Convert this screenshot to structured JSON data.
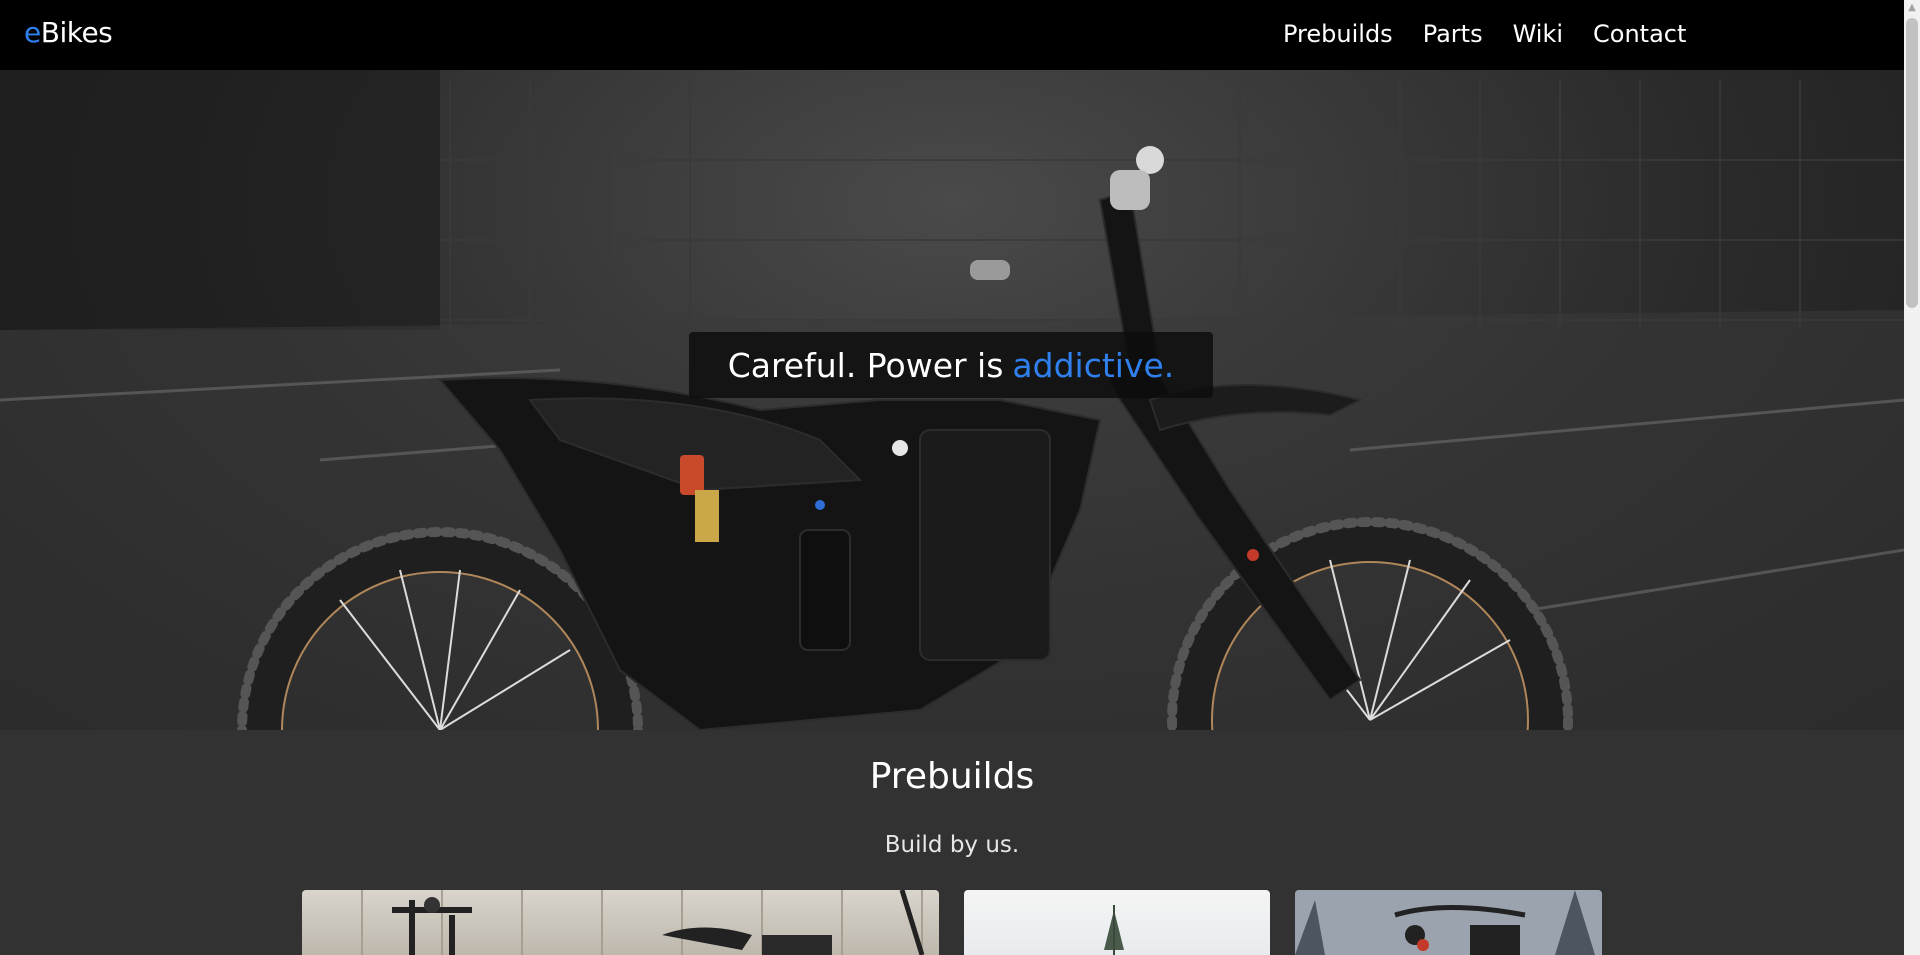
{
  "brand": {
    "prefix": "e",
    "rest": "Bikes"
  },
  "nav": {
    "items": [
      {
        "label": "Prebuilds"
      },
      {
        "label": "Parts"
      },
      {
        "label": "Wiki"
      },
      {
        "label": "Contact"
      }
    ]
  },
  "hero": {
    "tagline_main": "Careful. Power is",
    "tagline_accent": "addictive."
  },
  "prebuilds": {
    "title": "Prebuilds",
    "subtitle": "Build by us."
  },
  "colors": {
    "accent": "#2f80ed",
    "navbar": "#000000",
    "page_background": "#323232"
  }
}
